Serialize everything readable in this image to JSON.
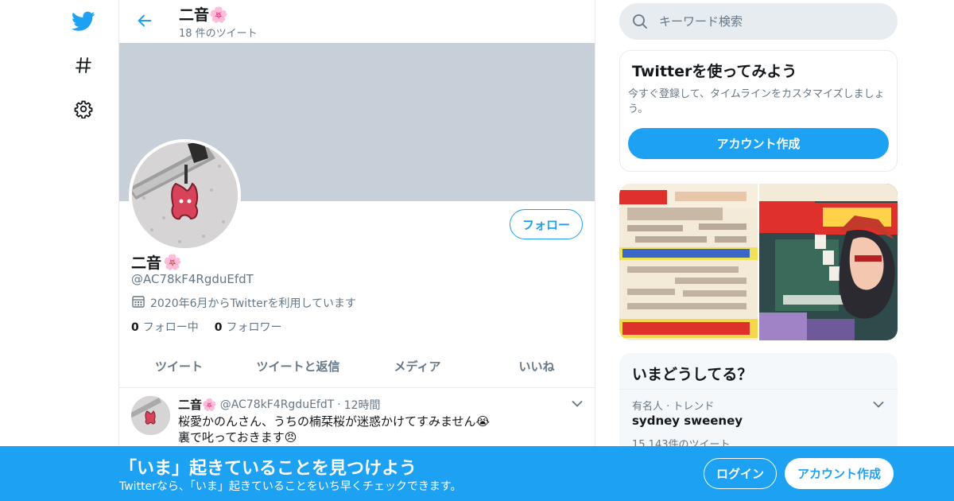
{
  "colors": {
    "brand": "#1da1f2",
    "banner": "#c7d0d8",
    "muted": "#657786"
  },
  "nav": {
    "icons": [
      "twitter-bird-icon",
      "hashtag-icon",
      "gear-icon"
    ]
  },
  "header": {
    "title": "二音",
    "title_emoji": "🌸",
    "tweet_count": "18 件のツイート"
  },
  "profile": {
    "follow_label": "フォロー",
    "name": "二音",
    "name_emoji": "🌸",
    "handle": "@AC78kF4RgduEfdT",
    "joined": "2020年6月からTwitterを利用しています",
    "following_count": "0",
    "following_label": "フォロー中",
    "followers_count": "0",
    "followers_label": "フォロワー"
  },
  "tabs": [
    "ツイート",
    "ツイートと返信",
    "メディア",
    "いいね"
  ],
  "tweet": {
    "name": "二音",
    "name_emoji": "🌸",
    "handle": "@AC78kF4RgduEfdT",
    "separator": "·",
    "time": "12時間",
    "line1": "桜愛かのんさん、うちの楠栞桜が迷惑かけてすみません😭",
    "line2": "裏で叱っておきます😠"
  },
  "search": {
    "placeholder": "キーワード検索"
  },
  "signup_card": {
    "title": "Twitterを使ってみよう",
    "description": "今すぐ登録して、タイムラインをカスタマイズしましょう。",
    "button": "アカウント作成"
  },
  "trends": {
    "title": "いまどうしてる？",
    "item_meta": "有名人 · トレンド",
    "item_name": "sydney sweeney",
    "item_count": "15,143件のツイート"
  },
  "bottom_bar": {
    "title": "「いま」起きていることを見つけよう",
    "subtitle": "Twitterなら、「いま」起きていることをいち早くチェックできます。",
    "login": "ログイン",
    "signup": "アカウント作成"
  }
}
